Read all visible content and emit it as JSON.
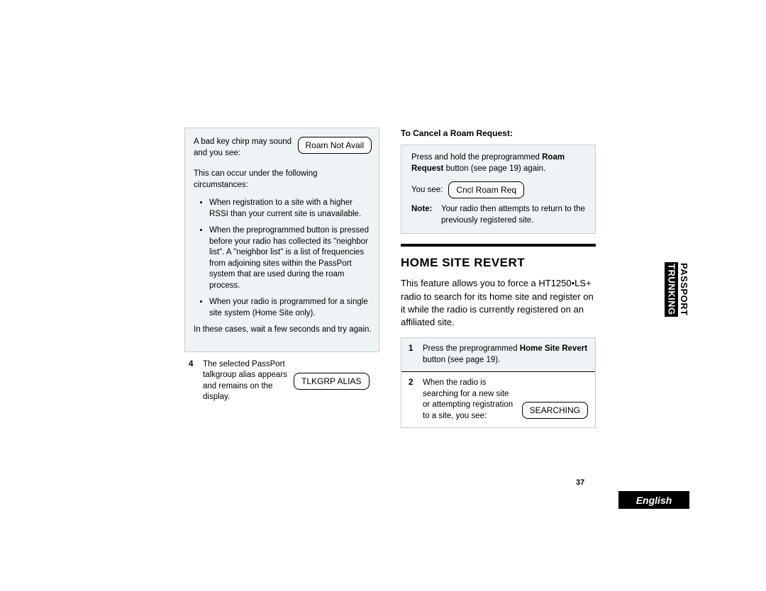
{
  "left": {
    "intro1": "A bad key chirp may sound and you see:",
    "disp1": "Roam Not Avail",
    "intro2": "This can occur under the following circumstances:",
    "bullets": [
      "When registration to a site with a higher RSSI than your current site is unavailable.",
      "When the preprogrammed button is pressed before your radio has collected its \"neighbor list\". A \"neighbor list\" is a list of frequencies from adjoining sites within the PassPort system that are used during the roam process.",
      "When your radio is programmed for a single site system (Home Site only)."
    ],
    "intro3": "In these cases, wait a few seconds and try again.",
    "step4num": "4",
    "step4text": "The selected PassPort talkgroup alias appears and remains on the display.",
    "disp2": "TLKGRP ALIAS"
  },
  "right": {
    "heading1": "To Cancel a Roam Request:",
    "box1_line1a": "Press and hold the preprogrammed ",
    "box1_line1b": "Roam Request",
    "box1_line1c": " button (see page 19) again.",
    "box1_yousee": "You see:",
    "disp3": "Cncl Roam Req",
    "note_label": "Note:",
    "note_text": "Your radio then attempts to return to the previously registered site.",
    "section": "HOME SITE REVERT",
    "body": "This feature allows you to force a HT1250•LS+ radio to search for its home site and register on it while the radio is currently registered on an affiliated site.",
    "s1num": "1",
    "s1a": "Press the preprogrammed ",
    "s1b": "Home Site Revert",
    "s1c": " button (see page 19).",
    "s2num": "2",
    "s2text": "When the radio is searching for a new site or attempting registration to a site, you see:",
    "disp4": "SEARCHING"
  },
  "sidebar": {
    "line1": "PASSPORT",
    "line2": "TRUNKING"
  },
  "footer": {
    "pagenum": "37",
    "lang": "English"
  }
}
